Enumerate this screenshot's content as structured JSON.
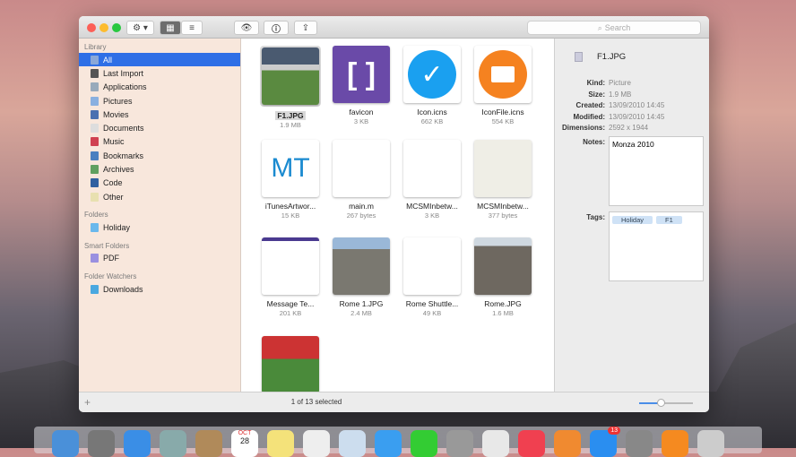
{
  "toolbar": {
    "search_placeholder": "Search"
  },
  "sidebar": {
    "library_header": "Library",
    "library": [
      {
        "label": "All",
        "color": "#8aa8d8"
      },
      {
        "label": "Last Import",
        "color": "#555"
      },
      {
        "label": "Applications",
        "color": "#9ab"
      },
      {
        "label": "Pictures",
        "color": "#8ab0e0"
      },
      {
        "label": "Movies",
        "color": "#4a70b0"
      },
      {
        "label": "Documents",
        "color": "#ddd"
      },
      {
        "label": "Music",
        "color": "#d04050"
      },
      {
        "label": "Bookmarks",
        "color": "#4a80c0"
      },
      {
        "label": "Archives",
        "color": "#60a060"
      },
      {
        "label": "Code",
        "color": "#3060a0"
      },
      {
        "label": "Other",
        "color": "#e8e0b0"
      }
    ],
    "folders_header": "Folders",
    "folders": [
      {
        "label": "Holiday",
        "color": "#6ab8ec"
      }
    ],
    "smart_header": "Smart Folders",
    "smart": [
      {
        "label": "PDF",
        "color": "#9a90e0"
      }
    ],
    "watchers_header": "Folder Watchers",
    "watchers": [
      {
        "label": "Downloads",
        "color": "#4aa8e0"
      }
    ]
  },
  "files": [
    {
      "name": "F1.JPG",
      "size": "1.9 MB"
    },
    {
      "name": "favicon",
      "size": "3 KB"
    },
    {
      "name": "Icon.icns",
      "size": "662 KB"
    },
    {
      "name": "IconFile.icns",
      "size": "554 KB"
    },
    {
      "name": "iTunesArtwor...",
      "size": "15 KB",
      "thumb_text": "MT"
    },
    {
      "name": "main.m",
      "size": "267 bytes"
    },
    {
      "name": "MCSMInbetw...",
      "size": "3 KB"
    },
    {
      "name": "MCSMInbetw...",
      "size": "377 bytes"
    },
    {
      "name": "Message Te...",
      "size": "201 KB"
    },
    {
      "name": "Rome 1.JPG",
      "size": "2.4 MB"
    },
    {
      "name": "Rome Shuttle...",
      "size": "49 KB"
    },
    {
      "name": "Rome.JPG",
      "size": "1.6 MB"
    },
    {
      "name": "",
      "size": ""
    }
  ],
  "inspector": {
    "filename": "F1.JPG",
    "fields": [
      {
        "k": "Kind:",
        "v": "Picture"
      },
      {
        "k": "Size:",
        "v": "1.9 MB"
      },
      {
        "k": "Created:",
        "v": "13/09/2010 14:45"
      },
      {
        "k": "Modified:",
        "v": "13/09/2010 14:45"
      },
      {
        "k": "Dimensions:",
        "v": "2592 x 1944"
      }
    ],
    "notes_label": "Notes:",
    "notes": "Monza 2010",
    "tags_label": "Tags:",
    "tags": [
      "Holiday",
      "F1"
    ]
  },
  "status": {
    "selection": "1 of 13 selected",
    "add_label": "+",
    "zoom_level": 0.4
  },
  "dock": {
    "calendar_month": "OCT",
    "calendar_day": "28",
    "app_store_badge": "13"
  }
}
